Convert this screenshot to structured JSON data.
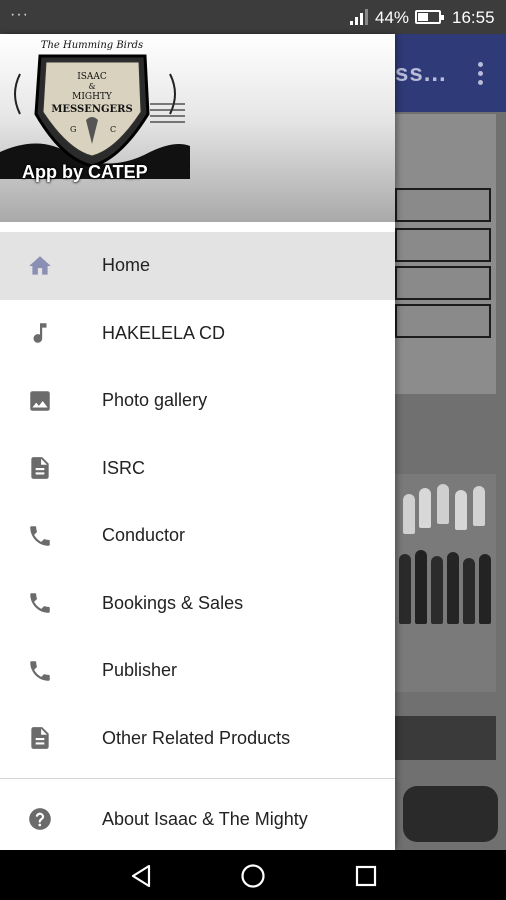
{
  "status_bar": {
    "battery_percent": "44%",
    "time": "16:55",
    "battery_level": 0.44
  },
  "background_app": {
    "toolbar_title": "ss...",
    "toolbar_color": "#2f3a78"
  },
  "drawer": {
    "header": {
      "caption": "App by CATEP",
      "logo_text": [
        "The Humming Birds",
        "ISAAC",
        "&",
        "MIGHTY",
        "MESSENGERS",
        "G",
        "C"
      ]
    },
    "menu_items": [
      {
        "label": "Home",
        "icon": "home-icon",
        "active": true
      },
      {
        "label": "HAKELELA CD",
        "icon": "music-note-icon"
      },
      {
        "label": "Photo gallery",
        "icon": "image-icon"
      },
      {
        "label": "ISRC",
        "icon": "document-icon"
      },
      {
        "label": "Conductor",
        "icon": "phone-icon"
      },
      {
        "label": "Bookings & Sales",
        "icon": "phone-icon"
      },
      {
        "label": "Publisher",
        "icon": "phone-icon"
      },
      {
        "label": "Other Related Products",
        "icon": "document-icon"
      }
    ],
    "about_item": {
      "label": "About Isaac & The Mighty",
      "icon": "help-circle-icon"
    }
  },
  "nav_bar": {
    "buttons": [
      "back-icon",
      "home-circle-icon",
      "recents-icon"
    ]
  },
  "colors": {
    "active_icon": "#8a8fb3",
    "icon": "#6b6b6b",
    "active_bg": "#e3e3e3"
  }
}
